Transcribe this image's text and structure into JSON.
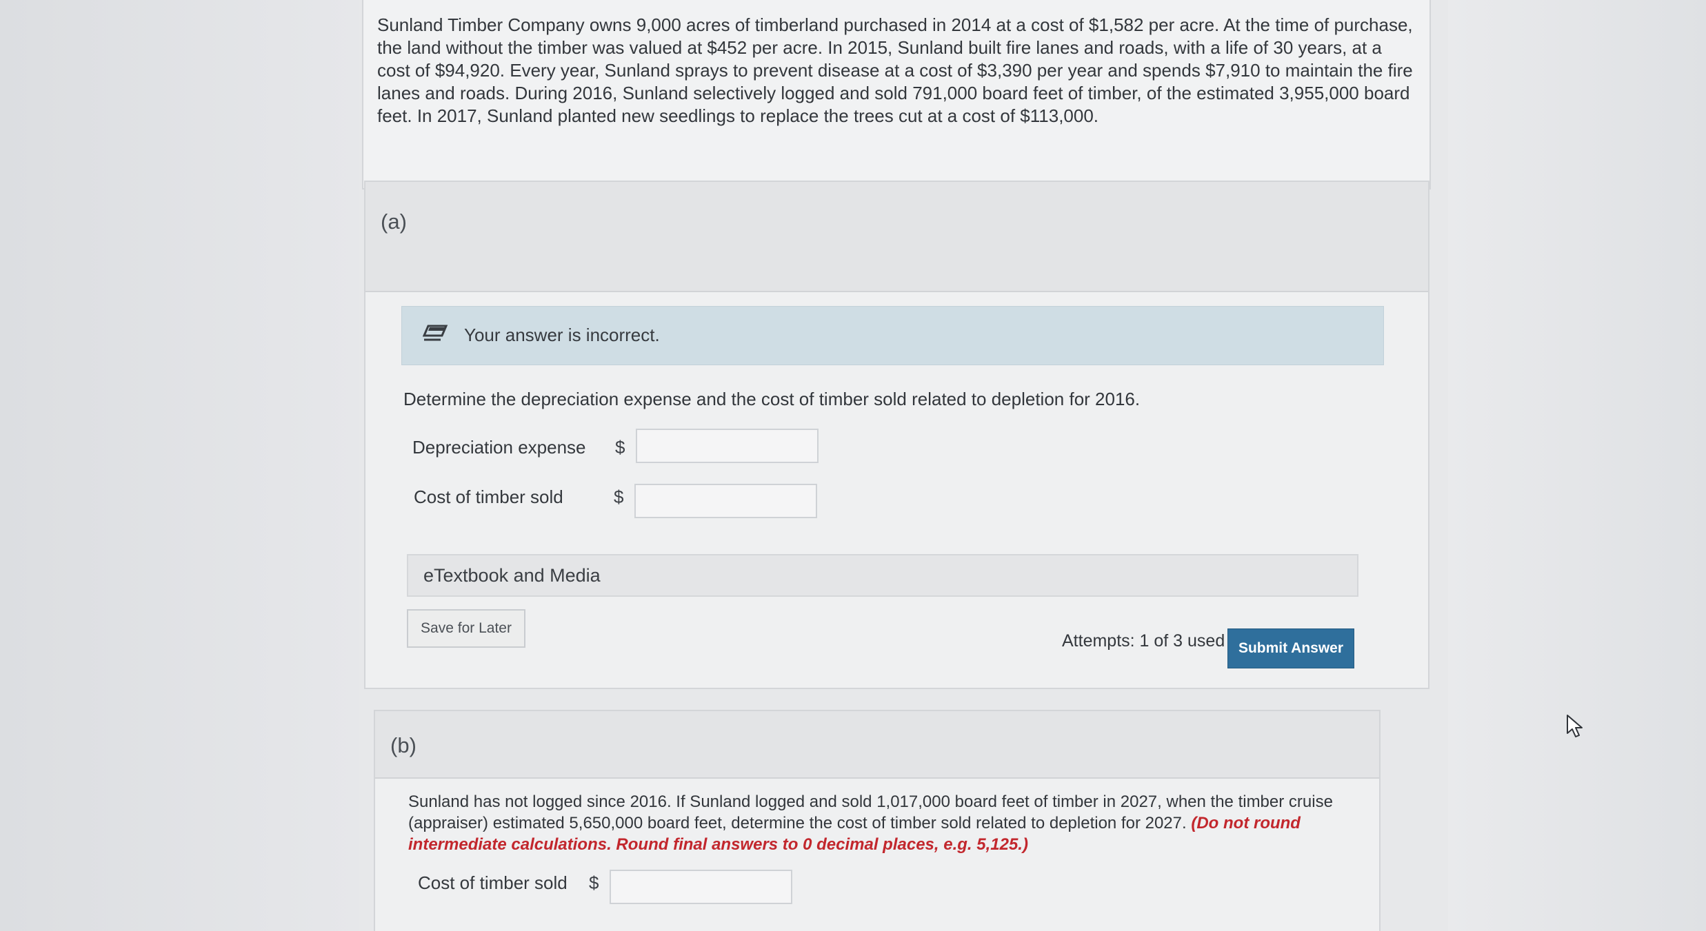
{
  "problem": {
    "text": "Sunland Timber Company owns 9,000 acres of timberland purchased in 2014 at a cost of $1,582 per acre. At the time of purchase, the land without the timber was valued at $452 per acre. In 2015, Sunland built fire lanes and roads, with a life of 30 years, at a cost of $94,920. Every year, Sunland sprays to prevent disease at a cost of $3,390 per year and spends $7,910 to maintain the fire lanes and roads. During 2016, Sunland selectively logged and sold 791,000 board feet of timber, of the estimated 3,955,000 board feet. In 2017, Sunland planted new seedlings to replace the trees cut at a cost of $113,000."
  },
  "part_a": {
    "label": "(a)",
    "feedback": "Your answer is incorrect.",
    "instruction": "Determine the depreciation expense and the cost of timber sold related to depletion for 2016.",
    "rows": [
      {
        "label": "Depreciation expense",
        "currency": "$",
        "value": ""
      },
      {
        "label": "Cost of timber sold",
        "currency": "$",
        "value": ""
      }
    ],
    "etextbook_label": "eTextbook and Media",
    "save_label": "Save for Later",
    "attempts": "Attempts: 1 of 3 used",
    "submit_label": "Submit Answer"
  },
  "part_b": {
    "label": "(b)",
    "text": "Sunland has not logged since 2016. If Sunland logged and sold 1,017,000 board feet of timber in 2027, when the timber cruise (appraiser) estimated 5,650,000 board feet, determine the cost of timber sold related to depletion for 2027.",
    "emphasis": "(Do not round intermediate calculations. Round final answers to 0 decimal places, e.g. 5,125.)",
    "row": {
      "label": "Cost of timber sold",
      "currency": "$",
      "value": ""
    }
  },
  "icons": {
    "feedback": "pencil-icon",
    "pointer": "cursor-icon"
  },
  "colors": {
    "submit_button": "#2f6f9c",
    "feedback_background": "#cfdde4",
    "emphasis_text": "#c2272d"
  }
}
